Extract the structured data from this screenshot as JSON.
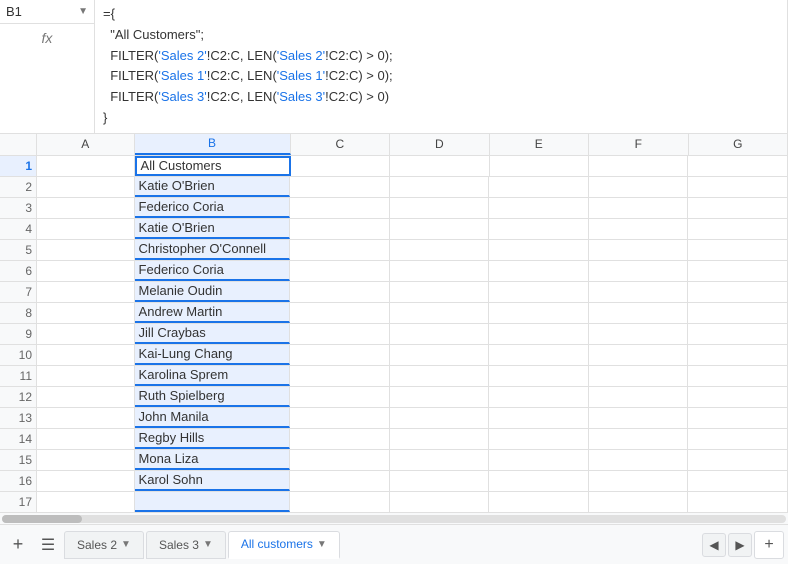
{
  "cell_ref": {
    "label": "B1",
    "arrow": "▼"
  },
  "fx_symbol": "fx",
  "formula": {
    "line1": "={",
    "line2": "  \"All Customers\";",
    "line3_prefix": "  FILTER(",
    "line3_sheet": "'Sales 2'",
    "line3_range": "!C2:C, LEN(",
    "line3_sheet2": "'Sales 2'",
    "line3_range2": "!C2:C) > 0);",
    "line4_prefix": "  FILTER(",
    "line4_sheet": "'Sales 1'",
    "line4_range": "!C2:C, LEN(",
    "line4_sheet2": "'Sales 1'",
    "line4_range2": "!C2:C) > 0);",
    "line5_prefix": "  FILTER(",
    "line5_sheet": "'Sales 3'",
    "line5_range": "!C2:C, LEN(",
    "line5_sheet2": "'Sales 3'",
    "line5_range2": "!C2:C) > 0)",
    "line6": "}"
  },
  "columns": [
    "A",
    "B",
    "C",
    "D",
    "E",
    "F",
    "G"
  ],
  "rows": [
    {
      "num": 1,
      "b": "All Customers",
      "active": true
    },
    {
      "num": 2,
      "b": "Katie O'Brien"
    },
    {
      "num": 3,
      "b": "Federico Coria"
    },
    {
      "num": 4,
      "b": "Katie O'Brien"
    },
    {
      "num": 5,
      "b": "Christopher O'Connell"
    },
    {
      "num": 6,
      "b": "Federico Coria"
    },
    {
      "num": 7,
      "b": "Melanie Oudin"
    },
    {
      "num": 8,
      "b": "Andrew Martin"
    },
    {
      "num": 9,
      "b": "Jill Craybas"
    },
    {
      "num": 10,
      "b": "Kai-Lung Chang"
    },
    {
      "num": 11,
      "b": "Karolina Sprem"
    },
    {
      "num": 12,
      "b": "Ruth Spielberg"
    },
    {
      "num": 13,
      "b": "John Manila"
    },
    {
      "num": 14,
      "b": "Regby Hills"
    },
    {
      "num": 15,
      "b": "Mona Liza"
    },
    {
      "num": 16,
      "b": "Karol Sohn"
    },
    {
      "num": 17,
      "b": ""
    }
  ],
  "tabs": {
    "add_label": "+",
    "menu_label": "☰",
    "sheet1": "Sales 2",
    "sheet2": "Sales 3",
    "sheet3": "All customers",
    "nav_prev": "◀",
    "nav_next": "▶",
    "add_sheet": "+"
  }
}
